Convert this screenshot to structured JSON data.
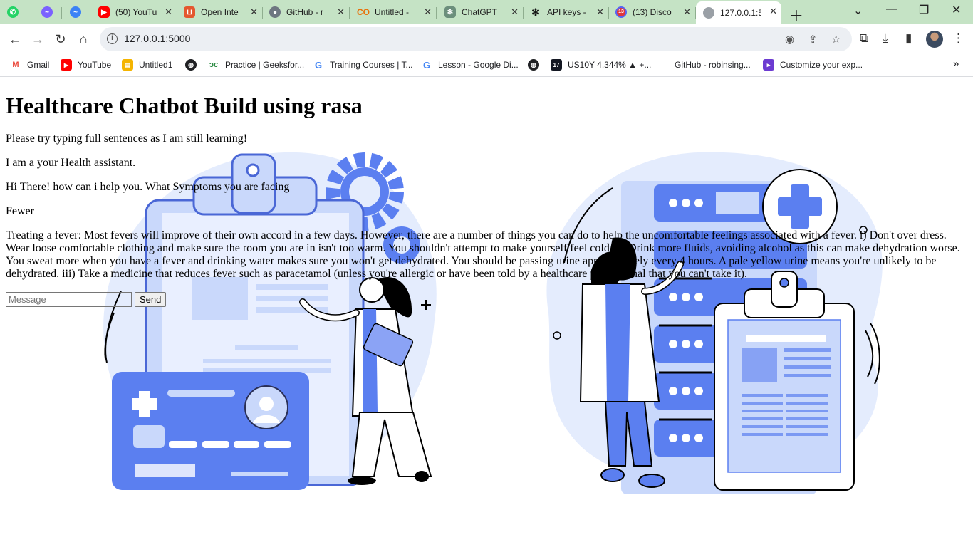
{
  "browser": {
    "tabs": [
      {
        "title": "",
        "icon": "whatsapp-icon",
        "color": "#25d366"
      },
      {
        "title": "",
        "icon": "messenger-icon",
        "color": "#7b61ff"
      },
      {
        "title": "",
        "icon": "messenger-icon",
        "color": "#3b82f6"
      },
      {
        "title": "(50) YouTu",
        "icon": "youtube-icon",
        "color": "#ff0000"
      },
      {
        "title": "Open Inte",
        "icon": "overleaf-icon",
        "color": "#e4572e"
      },
      {
        "title": "GitHub - r",
        "icon": "github-icon",
        "color": "#24292e"
      },
      {
        "title": "Untitled -",
        "icon": "colab-icon",
        "color": "#f9ab00"
      },
      {
        "title": "ChatGPT",
        "icon": "chatgpt-icon",
        "color": "#10a37f"
      },
      {
        "title": "API keys -",
        "icon": "openai-icon",
        "color": "#111111"
      },
      {
        "title": "(13) Disco",
        "icon": "discord-icon",
        "color": "#5865f2"
      },
      {
        "title": "127.0.0.1:5",
        "icon": "globe-icon",
        "color": "#9aa0a6"
      }
    ],
    "tab_badge": "13",
    "address": "127.0.0.1:5000",
    "bookmarks": [
      {
        "label": "Gmail",
        "icon": "gmail-icon",
        "color": "#ea4335"
      },
      {
        "label": "YouTube",
        "icon": "youtube-icon",
        "color": "#ff0000"
      },
      {
        "label": "Untitled1",
        "icon": "notebook-icon",
        "color": "#f4b400"
      },
      {
        "label": "",
        "icon": "globe-icon",
        "color": "#202124"
      },
      {
        "label": "Practice | Geeksfor...",
        "icon": "geeksforgeeks-icon",
        "color": "#2f8d46"
      },
      {
        "label": "Training Courses | T...",
        "icon": "google-icon",
        "color": "#4285f4"
      },
      {
        "label": "Lesson - Google Di...",
        "icon": "google-icon",
        "color": "#4285f4"
      },
      {
        "label": "",
        "icon": "globe-icon",
        "color": "#202124"
      },
      {
        "label": "US10Y 4.344% ▲ +...",
        "icon": "tradingview-icon",
        "color": "#131722"
      },
      {
        "label": "GitHub - robinsing...",
        "icon": "github-icon",
        "color": "#24292e"
      },
      {
        "label": "Customize your exp...",
        "icon": "customize-icon",
        "color": "#6c3bd1"
      }
    ]
  },
  "page": {
    "title": "Healthcare Chatbot Build using rasa",
    "messages": [
      "Please try typing full sentences as I am still learning!",
      "I am a your Health assistant.",
      "Hi There! how can i help you. What Symptoms you are facing",
      "Fewer",
      "Treating a fever: Most fevers will improve of their own accord in a few days. However, there are a number of things you can do to help the uncomfortable feelings associated with a fever. i) Don't over dress. Wear loose comfortable clothing and make sure the room you are in isn't too warm. You shouldn't attempt to make yourself feel cold. ii) Drink more fluids, avoiding alcohol as this can make dehydration worse. You sweat more when you have a fever and drinking water makes sure you won't get dehydrated. You should be passing urine approximately every 4 hours. A pale yellow urine means you're unlikely to be dehydrated. iii) Take a medicine that reduces fever such as paracetamol (unless you're allergic or have been told by a healthcare professional that you can't take it)."
    ],
    "input_placeholder": "Message",
    "send_label": "Send",
    "colors": {
      "accent": "#5b7ff0",
      "accent_light": "#c9d8fb",
      "accent_pale": "#e4ecfd"
    }
  }
}
